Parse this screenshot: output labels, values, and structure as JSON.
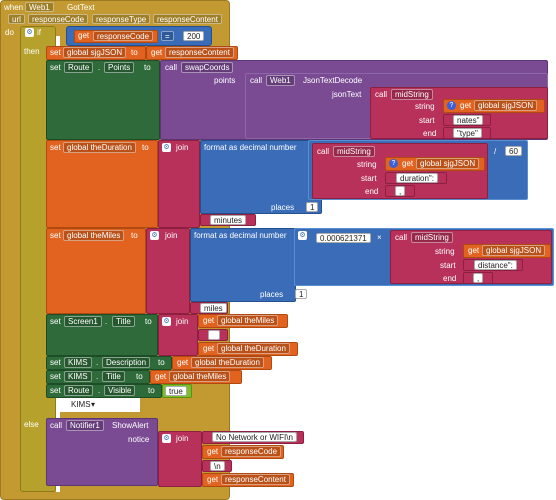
{
  "event": {
    "when": "when",
    "component": "Web1",
    "event_name": "GotText",
    "params": [
      "url",
      "responseCode",
      "responseType",
      "responseContent"
    ]
  },
  "ctrl": {
    "do": "do",
    "if": "if",
    "then": "then",
    "else": "else"
  },
  "cond": {
    "get": "get",
    "var": "responseCode",
    "op": "=",
    "value": "200"
  },
  "set1": {
    "set": "set",
    "var": "global sjgJSON",
    "to": "to",
    "get": "get",
    "val": "responseContent"
  },
  "set2": {
    "set": "set",
    "comp": "Route",
    "prop": "Points",
    "to": "to",
    "call": "call",
    "method": "swapCoords",
    "points": "points",
    "call2": "call",
    "comp2": "Web1",
    "method2": "JsonTextDecode",
    "jsonText": "jsonText",
    "call3": "call",
    "method3": "midString",
    "string": "string",
    "get": "get",
    "var": "global sjgJSON",
    "start": "start",
    "start_val": "nates\"",
    "end": "end",
    "end_val": "\"type\""
  },
  "set3": {
    "set": "set",
    "var": "global theDuration",
    "to": "to",
    "join": "join",
    "format": "format as decimal number",
    "call": "call",
    "method": "midString",
    "string": "string",
    "get": "get",
    "var2": "global sjgJSON",
    "start": "start",
    "start_val": "duration\":",
    "end": "end",
    "end_val": ",",
    "div": "/",
    "divisor": "60",
    "places": "places",
    "places_val": "1",
    "suffix": "minutes"
  },
  "set4": {
    "set": "set",
    "var": "global theMiles",
    "to": "to",
    "join": "join",
    "format": "format as decimal number",
    "factor": "0.000621371",
    "times": "×",
    "call": "call",
    "method": "midString",
    "string": "string",
    "get": "get",
    "var2": "global sjgJSON",
    "start": "start",
    "start_val": "distance\":",
    "end": "end",
    "end_val": ",",
    "places": "places",
    "places_val": "1",
    "suffix": "miles"
  },
  "set5": {
    "set": "set",
    "comp": "Screen1",
    "prop": "Title",
    "to": "to",
    "join": "join",
    "get": "get",
    "var1": "global theMiles",
    "sep": " ",
    "var2": "global theDuration"
  },
  "set6": {
    "set": "set",
    "comp": "KIMS",
    "prop": "Description",
    "to": "to",
    "get": "get",
    "var": "global theDuration"
  },
  "set7": {
    "set": "set",
    "comp": "KIMS",
    "prop": "Title",
    "to": "to",
    "get": "get",
    "var": "global theMiles"
  },
  "set8": {
    "set": "set",
    "comp": "Route",
    "prop": "Visible",
    "to": "to",
    "val": "true"
  },
  "kims_label": "KIMS",
  "alert": {
    "call": "call",
    "comp": "Notifier1",
    "method": "ShowAlert",
    "notice": "notice",
    "join": "join",
    "msg": "No Network or WIFI\\n",
    "get1": "get",
    "var1": "responseCode",
    "nl": "\\n",
    "get2": "get",
    "var2": "responseContent"
  }
}
